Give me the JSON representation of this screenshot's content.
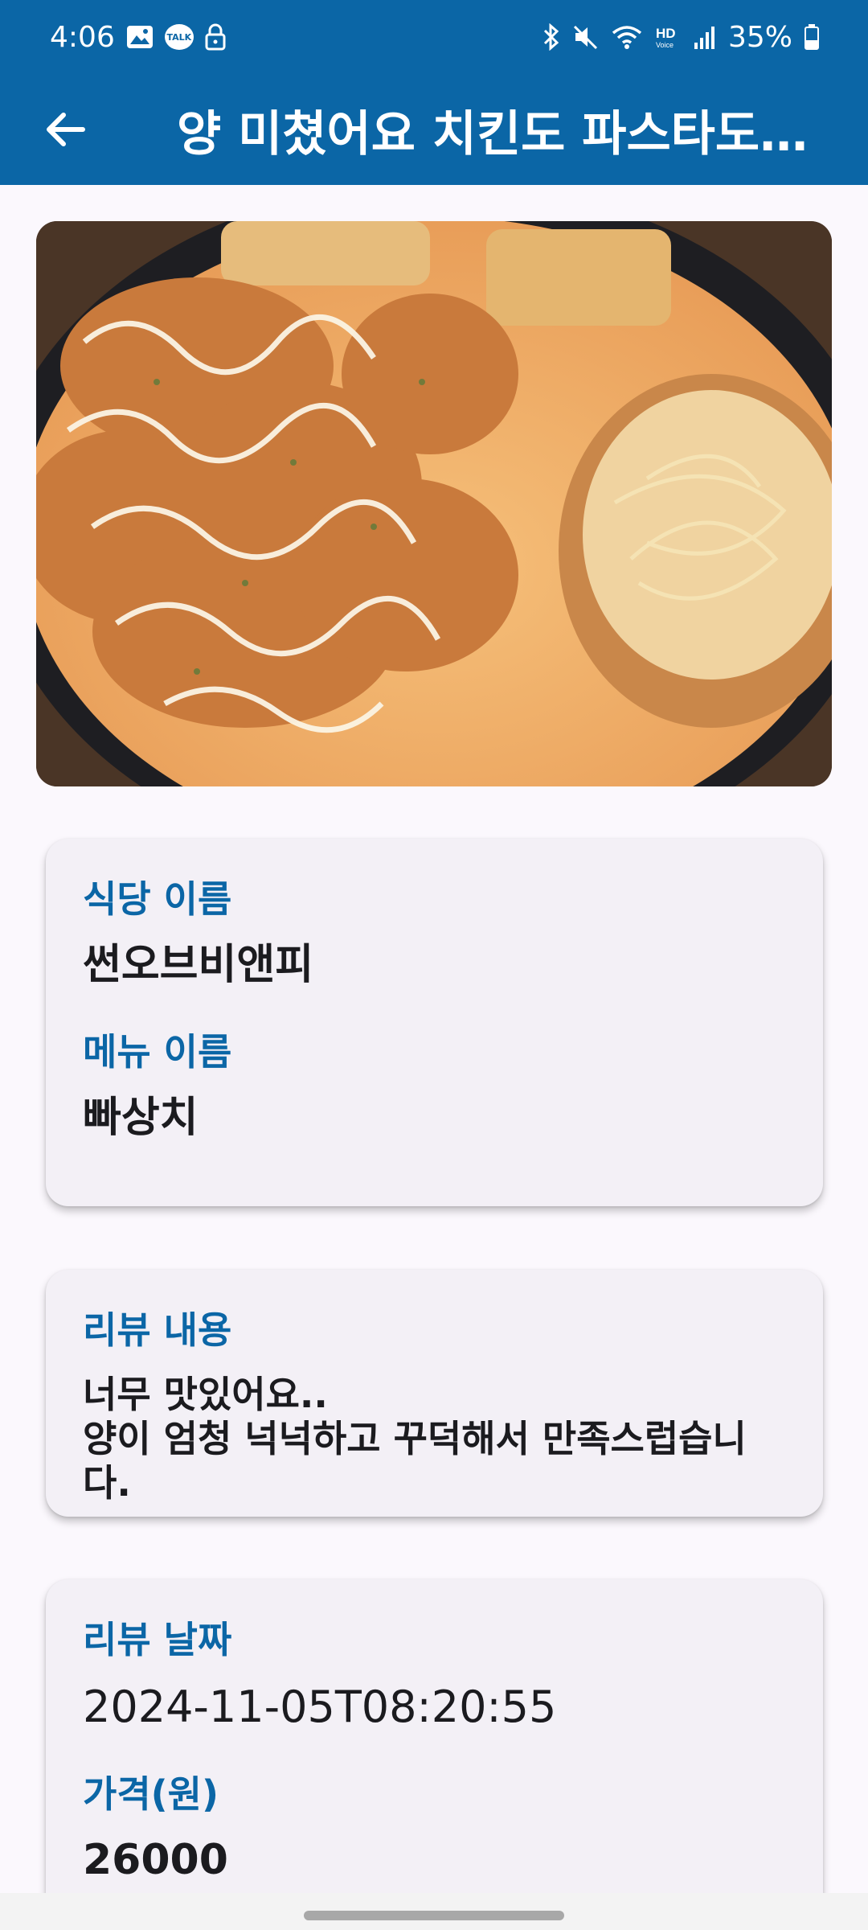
{
  "status_bar": {
    "time": "4:06",
    "battery": "35%",
    "icons": [
      "image-icon",
      "talk-icon",
      "lock-icon",
      "bluetooth-icon",
      "mute-icon",
      "wifi-icon",
      "hd-voice-icon",
      "signal-icon",
      "battery-icon"
    ]
  },
  "app_bar": {
    "back_icon": "arrow-left-icon",
    "title": "양 미쳤어요 치킨도 파스타도 미...",
    "color": "#0b66a6"
  },
  "info_card": {
    "restaurant_label": "식당 이름",
    "restaurant_value": "썬오브비앤피",
    "menu_label": "메뉴 이름",
    "menu_value": "빠상치"
  },
  "review_card": {
    "label": "리뷰 내용",
    "value": "너무 맛있어요..\n양이 엄청 넉넉하고 꾸덕해서 만족스럽습니다."
  },
  "meta_card": {
    "date_label": "리뷰 날짜",
    "date_value": "2024-11-05T08:20:55",
    "price_label": "가격(원)",
    "price_value": "26000"
  }
}
